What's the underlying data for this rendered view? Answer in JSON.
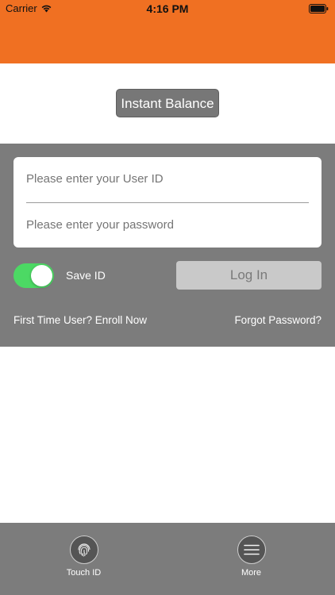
{
  "status_bar": {
    "carrier": "Carrier",
    "time": "4:16 PM"
  },
  "header": {
    "color": "#f07022"
  },
  "instant_balance": {
    "label": "Instant Balance"
  },
  "login_form": {
    "user_id_placeholder": "Please enter your User ID",
    "password_placeholder": "Please enter your password",
    "save_id": {
      "label": "Save ID",
      "checked": true,
      "toggle_color": "#4cd964"
    },
    "login_button_label": "Log In",
    "enroll_link": "First Time User? Enroll Now",
    "forgot_link": "Forgot Password?"
  },
  "tab_bar": {
    "tabs": [
      {
        "label": "Touch ID",
        "icon": "fingerprint-icon"
      },
      {
        "label": "More",
        "icon": "menu-icon"
      }
    ]
  }
}
